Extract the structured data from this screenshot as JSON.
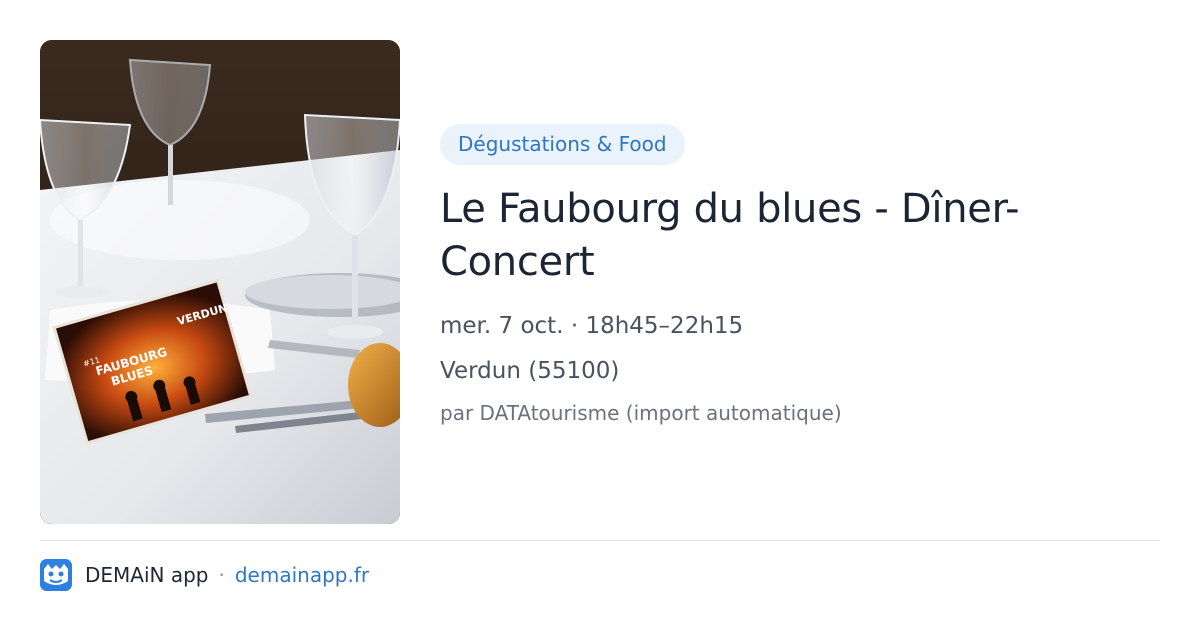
{
  "event": {
    "category": "Dégustations & Food",
    "title": "Le Faubourg du blues - Dîner-Concert",
    "datetime": "mer. 7 oct. · 18h45–22h15",
    "location": "Verdun (55100)",
    "source": "par DATAtourisme (import automatique)"
  },
  "photo": {
    "flyer_top": "VERDUN",
    "flyer_number": "#11",
    "flyer_title_line1": "FAUBOURG",
    "flyer_title_line2": "BLUES"
  },
  "footer": {
    "app_name": "DEMAiN app",
    "separator": "·",
    "url": "demainapp.fr"
  },
  "colors": {
    "accent": "#2f76c4",
    "badge_bg": "#eaf2fb",
    "logo_bg": "#2d7fe0"
  }
}
